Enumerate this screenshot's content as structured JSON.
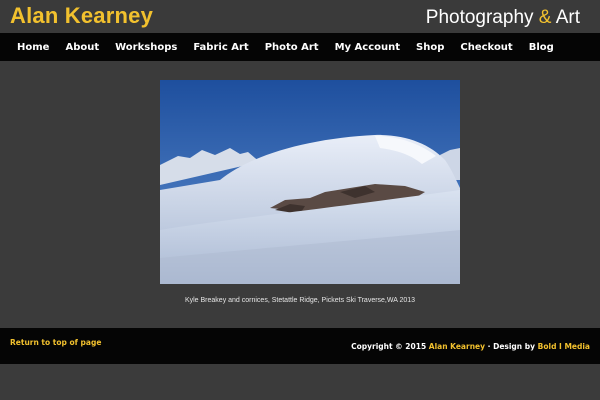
{
  "header": {
    "site_title": "Alan Kearney",
    "tagline_left": "Photography",
    "tagline_amp": "&",
    "tagline_right": "Art"
  },
  "nav": {
    "items": [
      {
        "label": "Home"
      },
      {
        "label": "About"
      },
      {
        "label": "Workshops"
      },
      {
        "label": "Fabric Art"
      },
      {
        "label": "Photo Art"
      },
      {
        "label": "My Account"
      },
      {
        "label": "Shop"
      },
      {
        "label": "Checkout"
      },
      {
        "label": "Blog"
      }
    ]
  },
  "main": {
    "caption": "Kyle Breakey and cornices, Stetattle Ridge, Pickets Ski Traverse,WA 2013"
  },
  "footer": {
    "back_to_top": "Return to top of page",
    "copyright_prefix": "Copyright © 2015 ",
    "copyright_name": "Alan Kearney",
    "copyright_mid": " · Design by ",
    "copyright_designer": "Bold I Media"
  },
  "colors": {
    "accent": "#f2c12e",
    "nav_bg": "#050505",
    "page_bg": "#3b3b3b"
  }
}
